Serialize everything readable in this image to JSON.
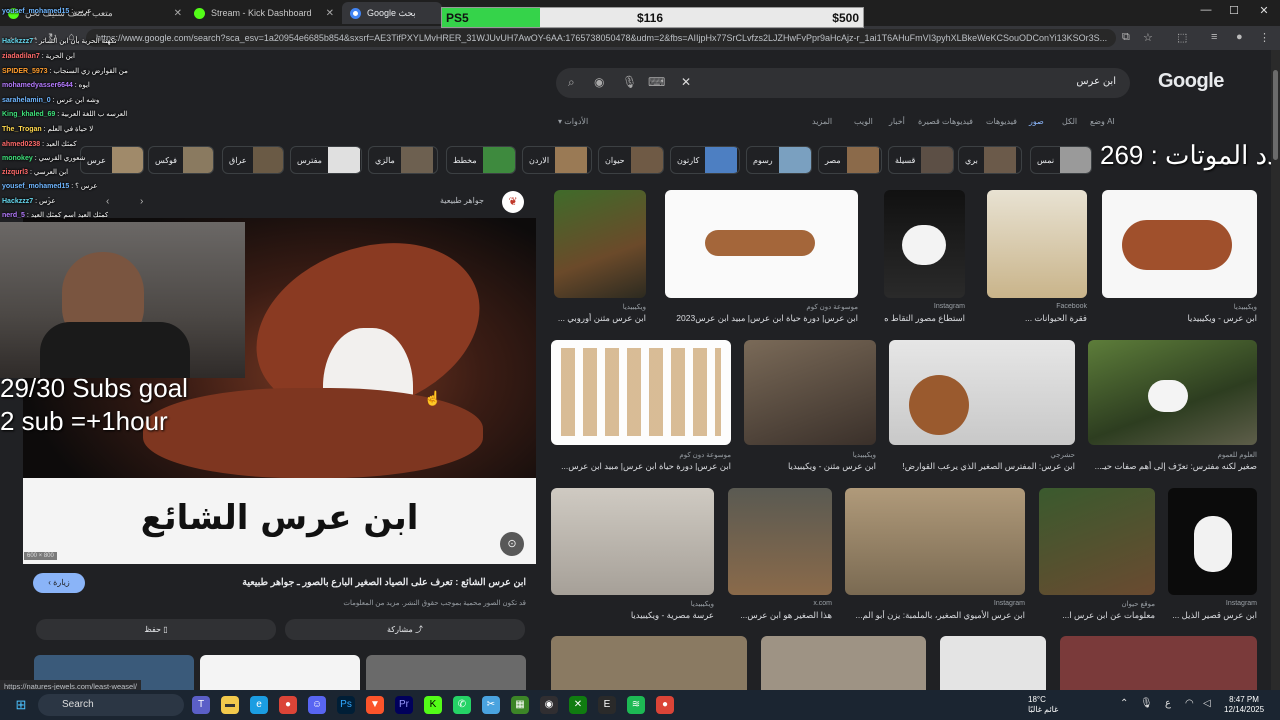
{
  "tabs": [
    {
      "label": "متعب استف ستيف نحن"
    },
    {
      "label": "Stream - Kick Dashboard"
    },
    {
      "label": "Google بحث"
    }
  ],
  "window_controls": [
    "—",
    "☐",
    "✕"
  ],
  "address_bar": {
    "url": "https://www.google.com/search?sca_esv=1a20954e6685b854&sxsrf=AE3TifPXYLMvHRER_31WJUvUH7AwOY-6AA:1765738050478&udm=2&fbs=AIIjpHx77SrCLvfzs2LJZHwFvPpr9aHcAjz-r_1ai1T6AHuFmVI3pyhXLBkeWeKCSouODConYi13KSOr3S..."
  },
  "ps5_bar": {
    "label": "PS5",
    "current": "$116",
    "goal": "$500",
    "progress": 0.232
  },
  "google": {
    "logo": "Google",
    "query": "ابن عرس",
    "tabs": [
      "وضع AI",
      "الكل",
      "صور",
      "فيديوهات",
      "فيديوهات قصيرة",
      "أخبار",
      "الويب",
      "المزيد"
    ],
    "tools": "الأدوات"
  },
  "chips": [
    "نمس",
    "بري",
    "قسيلة",
    "مصر",
    "رسوم",
    "كارتون",
    "حيوان",
    "الاردن",
    "مخطط",
    "مالزي",
    "مفترس",
    "عراق",
    "فوكس",
    "عرس"
  ],
  "overlay": {
    "death_count": "عدد الموتات : 269",
    "subs_goal_line1": "29/30 Subs goal",
    "subs_goal_line2": "2 sub =+1hour"
  },
  "results": [
    {
      "source": "ويكيبيديا",
      "title": "ابن عرس مثنن أوروبي ..."
    },
    {
      "source": "موسوعة دون كوم",
      "title": "ابن عرس| دورة حياة ابن عرس| مبيد ابن عرس2023"
    },
    {
      "source": "Instagram",
      "title": "استطاع مصور التقاط ه..."
    },
    {
      "source": "Facebook",
      "title": "فقرة الحيوانات ..."
    },
    {
      "source": "ويكيبيديا",
      "title": "ابن عرس - ويكيبيديا"
    },
    {
      "source": "موسوعة دون كوم",
      "title": "ابن عرس| دورة حياة ابن عرس| مبيد ابن عرس..."
    },
    {
      "source": "ويكيبيديا",
      "title": "ابن عرس مثنن - ويكيبيديا"
    },
    {
      "source": "حشرجي",
      "title": "ابن عرس: المفترس الصغير الذي يرعب القوارض!"
    },
    {
      "source": "العلوم للعموم",
      "title": "صغير لكنه مفترس: تعرّف إلى أهم صفات حيـ..."
    },
    {
      "source": "ويكيبيديا",
      "title": "عرسة مصرية - ويكيبيديا"
    },
    {
      "source": "x.com",
      "title": "هذا الصغير هو ابن عرس..."
    },
    {
      "source": "Instagram",
      "title": "ابن عرس الأميوي الصغير، بالملمبة: يزن أبو الم..."
    },
    {
      "source": "موقع حيوان",
      "title": "معلومات عن ابن عرس ا..."
    },
    {
      "source": "Instagram",
      "title": "ابن عرس قصير الذيل ..."
    }
  ],
  "panel": {
    "source_name": "جواهر طبيعية",
    "image_caption": "ابن عرس الشائع",
    "image_size": "600 × 800",
    "visit": "زيارة",
    "title": "ابن عرس الشائع : تعرف على الصياد الصغير البارع بالصور ـ جواهر طبيعية",
    "subtitle": "قد تكون الصور محمية بموجب حقوق النشر. مزيد من المعلومات",
    "save": "حفظ",
    "share": "مشاركة"
  },
  "chat": [
    {
      "user": "yousef_mohamed15",
      "msg": ": عرس",
      "color": "#6fb6ff"
    },
    {
      "user": "Hackzzz7",
      "msg": ": تكهنة الحرية بأن ابن الشاتر",
      "color": "#66d9ef"
    },
    {
      "user": "ziadadilan7",
      "msg": ": ابن الحرية",
      "color": "#ff6a6a"
    },
    {
      "user": "SPIDER_5973",
      "msg": ": من القوارض زي السنجاب",
      "color": "#ff9d2e"
    },
    {
      "user": "mohamedyasser6644",
      "msg": ": ايوه",
      "color": "#b57bff"
    },
    {
      "user": "sarahelamin_0",
      "msg": ": وشه ابن عرس",
      "color": "#6fb6ff"
    },
    {
      "user": "King_khaled_69",
      "msg": ": العرسه ب اللغة العربية",
      "color": "#3ee07a"
    },
    {
      "user": "The_Trogan",
      "msg": ": لا حياة في العلم",
      "color": "#ffd84d"
    },
    {
      "user": "ahmed0238",
      "msg": ": كمثك العيد",
      "color": "#ff6a6a"
    },
    {
      "user": "monokey",
      "msg": ": شعوري القرسي",
      "color": "#3ee07a"
    },
    {
      "user": "zizqurl3",
      "msg": ": ابن العرسي",
      "color": "#ff6a6a"
    },
    {
      "user": "yousef_mohamed15",
      "msg": ": عرس ؟",
      "color": "#6fb6ff"
    },
    {
      "user": "Hackzzz7",
      "msg": ": عرس",
      "color": "#66d9ef"
    },
    {
      "user": "nerd_5",
      "msg": ": كمثك العيد اسم كمثك العيد",
      "color": "#b57bff"
    }
  ],
  "status_url": "https://natures-jewels.com/least-weasel/",
  "taskbar": {
    "search": "Search",
    "weather_temp": "18°C",
    "weather_desc": "غائم غالبًا",
    "time": "8:47 PM",
    "date": "12/14/2025",
    "lang": "ع"
  },
  "colors": {
    "accent": "#8ab4f8",
    "progress_green": "#35d34a",
    "background": "#202124"
  }
}
